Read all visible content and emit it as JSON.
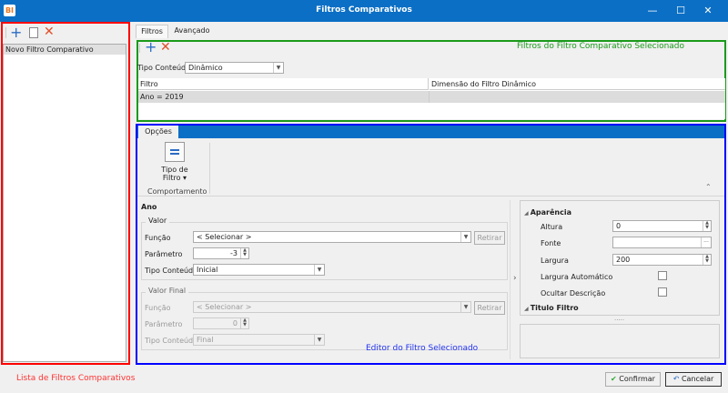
{
  "window": {
    "title": "Filtros Comparativos",
    "logo": "BI",
    "minimize": "—",
    "maximize": "☐",
    "close": "✕"
  },
  "left_panel": {
    "items": [
      "Novo Filtro Comparativo"
    ],
    "annotation": "Lista de Filtros Comparativos"
  },
  "tabs": [
    {
      "label": "Filtros",
      "active": true
    },
    {
      "label": "Avançado",
      "active": false
    }
  ],
  "filters": {
    "annotation": "Filtros do Filtro Comparativo Selecionado",
    "tipo_conteudo_label": "Tipo Conteúdo",
    "tipo_conteudo_value": "Dinâmico",
    "columns": [
      "Filtro",
      "Dimensão do Filtro Dinâmico"
    ],
    "rows": [
      [
        "Ano = 2019",
        ""
      ]
    ]
  },
  "ribbon": {
    "tab": "Opções",
    "button_line1": "Tipo de",
    "button_line2": "Filtro ▾",
    "group": "Comportamento"
  },
  "editor": {
    "annotation": "Editor do Filtro Selecionado",
    "field": "Ano",
    "valor": {
      "title": "Valor",
      "funcao_label": "Função",
      "funcao_value": "< Selecionar >",
      "retirar": "Retirar",
      "parametro_label": "Parâmetro",
      "parametro_value": "-3",
      "tipo_label": "Tipo Conteúdo",
      "tipo_value": "Inicial"
    },
    "valor_final": {
      "title": "Valor Final",
      "funcao_label": "Função",
      "funcao_value": "< Selecionar >",
      "retirar": "Retirar",
      "parametro_label": "Parâmetro",
      "parametro_value": "0",
      "tipo_label": "Tipo Conteúdo",
      "tipo_value": "Final"
    }
  },
  "properties": {
    "cat1": "Aparência",
    "altura_label": "Altura",
    "altura_value": "0",
    "fonte_label": "Fonte",
    "fonte_value": "",
    "largura_label": "Largura",
    "largura_value": "200",
    "largura_auto_label": "Largura Automático",
    "largura_auto": false,
    "ocultar_label": "Ocultar Descrição",
    "ocultar": false,
    "cat2": "Titulo Filtro"
  },
  "footer": {
    "confirm": "Confirmar",
    "cancel": "Cancelar"
  },
  "colors": {
    "titlebar": "#0b6fc5",
    "red_box": "#ff0000",
    "green_box": "#1a9a1a",
    "blue_box": "#0000ff"
  }
}
